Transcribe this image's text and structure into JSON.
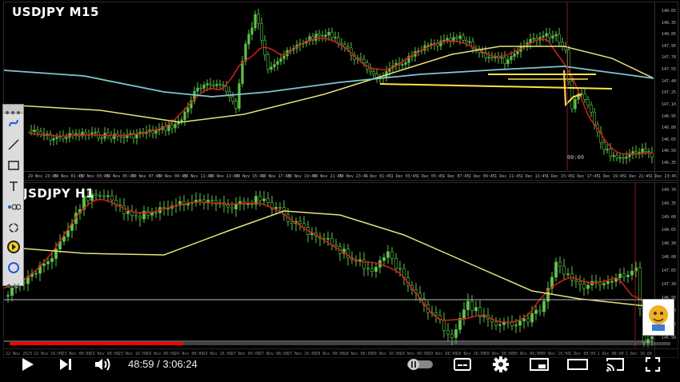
{
  "charts": {
    "m15": {
      "title": "USDJPY  M15",
      "price_ticks": [
        "148.65",
        "148.35",
        "148.05",
        "147.95",
        "147.70",
        "147.55",
        "147.40",
        "147.25",
        "147.10",
        "146.95",
        "146.80",
        "146.65",
        "146.50",
        "146.35"
      ],
      "time_ticks": [
        "29 Nov 23:45",
        "30 Nov 01:45",
        "30 Nov 03:45",
        "30 Nov 05:45",
        "30 Nov 07:45",
        "30 Nov 09:45",
        "30 Nov 11:45",
        "30 Nov 13:45",
        "30 Nov 15:45",
        "30 Nov 17:45",
        "30 Nov 19:45",
        "30 Nov 21:45",
        "30 Nov 23:45",
        "1 Dec 01:45",
        "1 Dec 03:45",
        "1 Dec 05:45",
        "1 Dec 07:45",
        "1 Dec 09:45",
        "1 Dec 11:45",
        "1 Dec 13:45",
        "1 Dec 15:45",
        "1 Dec 17:45",
        "1 Dec 19:45",
        "1 Dec 21:45",
        "1 Dec 23:45"
      ],
      "marker_label": "00:00"
    },
    "h1": {
      "title": "JSDJPY  H1",
      "price_ticks": [
        "149.70",
        "149.35",
        "149.00",
        "148.65",
        "148.30",
        "148.00",
        "147.65",
        "147.30",
        "146.95",
        "146.60",
        "146.25",
        "145.90"
      ],
      "time_ticks": [
        "22 Nov 2023",
        "22 Nov 16:00",
        "23 Nov 00:00",
        "23 Nov 08:00",
        "23 Nov 16:00",
        "24 Nov 00:00",
        "24 Nov 08:00",
        "24 Nov 16:00",
        "27 Nov 00:00",
        "27 Nov 08:00",
        "27 Nov 16:00",
        "28 Nov 00:00",
        "28 Nov 08:00",
        "28 Nov 16:00",
        "29 Nov 00:00",
        "29 Nov 08:00",
        "29 Nov 16:00",
        "30 Nov 00:00",
        "30 Nov 08:00",
        "30 Nov 16:00",
        "1 Dec 00:00",
        "1 Dec 08:00",
        "1 Dec 16:00"
      ]
    }
  },
  "colors": {
    "candle": "#5ec24a",
    "ma_red": "#d42020",
    "ma_yellow": "#e8e27a",
    "ma_cyan": "#7fc7d0",
    "annotation": "#ffe14d",
    "vline": "#8b1a1a",
    "progress": "#ff0000"
  },
  "toolbar": {
    "tools": [
      "curve-tool-icon",
      "line-tool-icon",
      "rectangle-tool-icon",
      "text-tool-icon",
      "path-tool-icon",
      "cycle-tool-icon",
      "highlighter-tool-icon",
      "circle-tool-icon"
    ]
  },
  "player": {
    "time_display": "48:59 / 3:06:24",
    "progress": 0.263
  }
}
